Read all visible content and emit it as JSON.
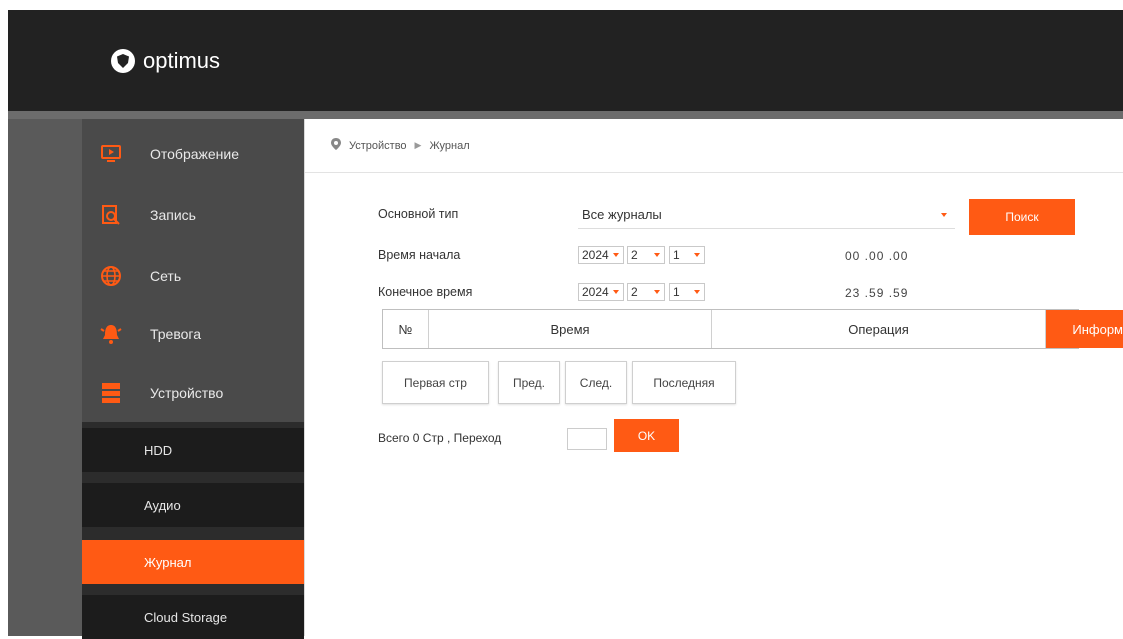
{
  "brand": {
    "name": "optimus"
  },
  "sidebar": {
    "items": [
      {
        "label": "Отображение",
        "icon": "monitor-icon"
      },
      {
        "label": "Запись",
        "icon": "record-search-icon"
      },
      {
        "label": "Сеть",
        "icon": "globe-icon"
      },
      {
        "label": "Тревога",
        "icon": "alarm-bell-icon"
      },
      {
        "label": "Устройство",
        "icon": "device-icon"
      }
    ],
    "subitems": [
      {
        "label": "HDD"
      },
      {
        "label": "Аудио"
      },
      {
        "label": "Журнал",
        "active": true
      },
      {
        "label": "Cloud Storage"
      }
    ]
  },
  "breadcrumb": {
    "section": "Устройство",
    "page": "Журнал"
  },
  "form": {
    "main_type_label": "Основной тип",
    "main_type_value": "Все журналы",
    "search_button": "Поиск",
    "start_label": "Время начала",
    "start_year": "2024",
    "start_month": "2",
    "start_day": "1",
    "start_time": "00 .00 .00",
    "end_label": "Конечное время",
    "end_year": "2024",
    "end_month": "2",
    "end_day": "1",
    "end_time": "23 .59 .59"
  },
  "table": {
    "headers": [
      "№",
      "Время",
      "Операция",
      "Информ."
    ]
  },
  "pager": {
    "first": "Первая стр",
    "prev": "Пред.",
    "next": "След.",
    "last": "Последняя",
    "summary": "Всего 0 Стр , Переход",
    "ok": "OK"
  },
  "colors": {
    "accent": "#ff5a14",
    "header_bg": "#222222",
    "sidebar_bg": "#4a4a4a",
    "submenu_bg": "#1c1c1c"
  }
}
